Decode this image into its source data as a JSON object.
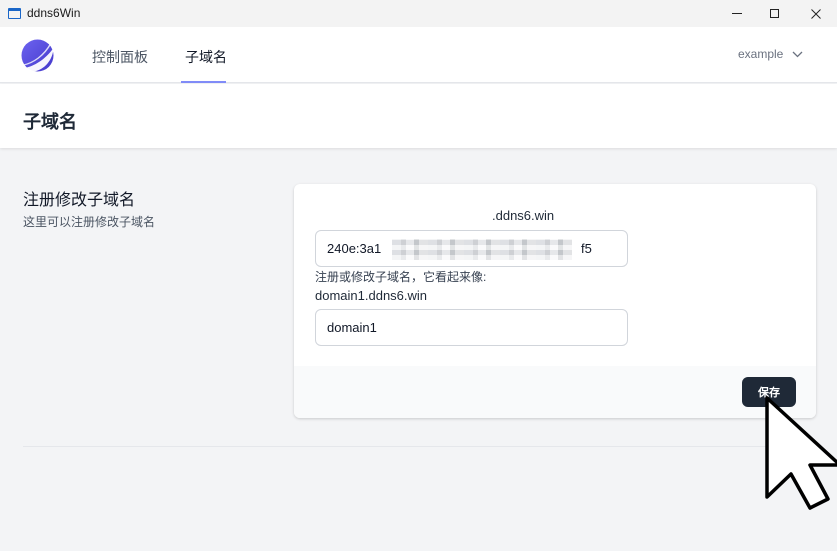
{
  "window": {
    "title": "ddns6Win",
    "icon": "window-app-icon",
    "controls": [
      "minimize-icon",
      "maximize-icon",
      "close-icon"
    ]
  },
  "nav": {
    "logo": "crescent-logo",
    "items": [
      {
        "label": "控制面板",
        "active": false
      },
      {
        "label": "子域名",
        "active": true
      }
    ],
    "user": {
      "label": "example",
      "icon": "chevron-down-icon"
    },
    "accent_color": "#818cf8"
  },
  "page": {
    "title": "子域名"
  },
  "section": {
    "title": "注册修改子域名",
    "description": "这里可以注册修改子域名"
  },
  "form": {
    "domain_suffix": ".ddns6.win",
    "ipv6_prefix": "240e:3a1",
    "ipv6_suffix": "f5",
    "ipv6_obscured": true,
    "help_text": "注册或修改子域名，它看起来像:",
    "example_domain": "domain1.ddns6.win",
    "subdomain_value": "domain1",
    "save_label": "保存",
    "save_color": "#1f2937"
  },
  "cursor": {
    "icon": "mouse-pointer-icon",
    "target": "save-button"
  }
}
